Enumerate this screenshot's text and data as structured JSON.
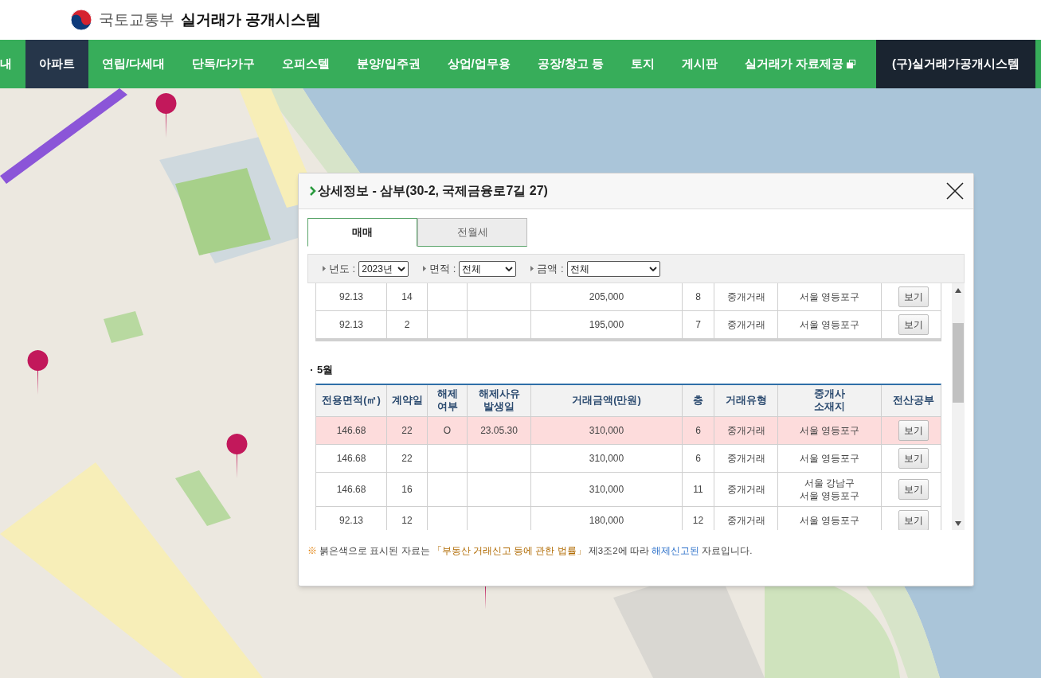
{
  "header": {
    "ministry": "국토교통부",
    "system_title": "실거래가 공개시스템"
  },
  "nav": [
    {
      "label": "내",
      "selected": false,
      "kind": "menu"
    },
    {
      "label": "아파트",
      "selected": true,
      "kind": "menu"
    },
    {
      "label": "연립/다세대",
      "selected": false,
      "kind": "menu"
    },
    {
      "label": "단독/다가구",
      "selected": false,
      "kind": "menu"
    },
    {
      "label": "오피스텔",
      "selected": false,
      "kind": "menu"
    },
    {
      "label": "분양/입주권",
      "selected": false,
      "kind": "menu"
    },
    {
      "label": "상업/업무용",
      "selected": false,
      "kind": "menu"
    },
    {
      "label": "공장/창고 등",
      "selected": false,
      "kind": "menu"
    },
    {
      "label": "토지",
      "selected": false,
      "kind": "menu"
    },
    {
      "label": "게시판",
      "selected": false,
      "kind": "menu"
    },
    {
      "label": "실거래가 자료제공",
      "selected": false,
      "kind": "external"
    },
    {
      "label": "(구)실거래가공개시스템",
      "selected": false,
      "kind": "legacy"
    }
  ],
  "dialog": {
    "title": "상세정보 - 삼부(30-2, 국제금융로7길 27)",
    "tabs": [
      {
        "label": "매매",
        "selected": true
      },
      {
        "label": "전월세",
        "selected": false
      }
    ],
    "filters": [
      {
        "label": "년도 :",
        "value": "2023년"
      },
      {
        "label": "면적 :",
        "value": "전체"
      },
      {
        "label": "금액 :",
        "value": "전체"
      }
    ],
    "upper_rows": [
      {
        "area": "92.13",
        "day": "14",
        "cancel": "",
        "cancel_date": "",
        "price": "205,000",
        "floor": "8",
        "type": "중개거래",
        "broker": [
          "서울 영등포구"
        ],
        "button": "보기",
        "cancelled": false
      },
      {
        "area": "92.13",
        "day": "2",
        "cancel": "",
        "cancel_date": "",
        "price": "195,000",
        "floor": "7",
        "type": "중개거래",
        "broker": [
          "서울 영등포구"
        ],
        "button": "보기",
        "cancelled": false
      }
    ],
    "section": {
      "label": "5월",
      "columns": [
        [
          "전용면적(㎡)"
        ],
        [
          "계약일"
        ],
        [
          "해제",
          "여부"
        ],
        [
          "해제사유",
          "발생일"
        ],
        [
          "거래금액(만원)"
        ],
        [
          "층"
        ],
        [
          "거래유형"
        ],
        [
          "중개사",
          "소재지"
        ],
        [
          "전산공부"
        ]
      ],
      "rows": [
        {
          "area": "146.68",
          "day": "22",
          "cancel": "O",
          "cancel_date": "23.05.30",
          "price": "310,000",
          "floor": "6",
          "type": "중개거래",
          "broker": [
            "서울 영등포구"
          ],
          "button": "보기",
          "cancelled": true
        },
        {
          "area": "146.68",
          "day": "22",
          "cancel": "",
          "cancel_date": "",
          "price": "310,000",
          "floor": "6",
          "type": "중개거래",
          "broker": [
            "서울 영등포구"
          ],
          "button": "보기",
          "cancelled": false
        },
        {
          "area": "146.68",
          "day": "16",
          "cancel": "",
          "cancel_date": "",
          "price": "310,000",
          "floor": "11",
          "type": "중개거래",
          "broker": [
            "서울 강남구",
            "서울 영등포구"
          ],
          "button": "보기",
          "cancelled": false
        },
        {
          "area": "92.13",
          "day": "12",
          "cancel": "",
          "cancel_date": "",
          "price": "180,000",
          "floor": "12",
          "type": "중개거래",
          "broker": [
            "서울 영등포구"
          ],
          "button": "보기",
          "cancelled": false
        }
      ]
    },
    "note": [
      {
        "text": "※",
        "kind": "mark"
      },
      {
        "text": " 붉은색으로 표시된 자료는 ",
        "kind": "plain"
      },
      {
        "text": "「부동산 거래신고 등에 관한 법률」",
        "kind": "law"
      },
      {
        "text": " 제3조2에 따라 ",
        "kind": "plain"
      },
      {
        "text": "해제신고된",
        "kind": "highlight"
      },
      {
        "text": " 자료입니다.",
        "kind": "plain"
      }
    ]
  }
}
